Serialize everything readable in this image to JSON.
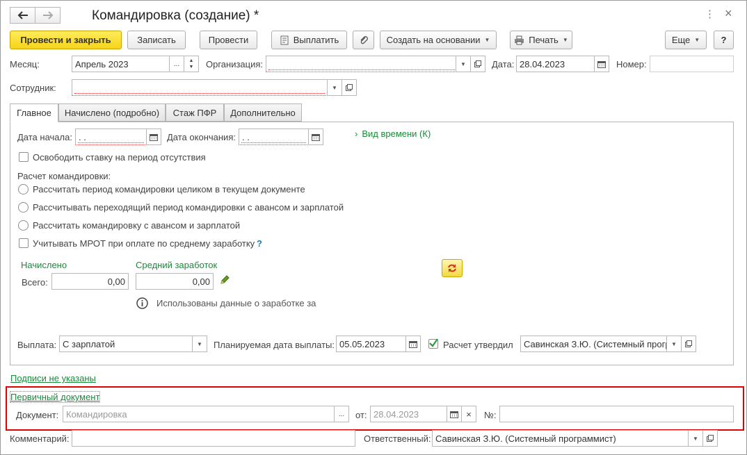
{
  "window": {
    "title": "Командировка (создание) *",
    "more_icon": "⋮",
    "close_icon": "×"
  },
  "toolbar": {
    "post_close": "Провести и закрыть",
    "save": "Записать",
    "post": "Провести",
    "pay": "Выплатить",
    "create_based": "Создать на основании",
    "print": "Печать",
    "more": "Еще",
    "help": "?"
  },
  "header": {
    "month_label": "Месяц:",
    "month_value": "Апрель 2023",
    "org_label": "Организация:",
    "org_value": "",
    "date_label": "Дата:",
    "date_value": "28.04.2023",
    "number_label": "Номер:",
    "number_value": "",
    "employee_label": "Сотрудник:",
    "employee_value": ""
  },
  "tabs": [
    "Главное",
    "Начислено (подробно)",
    "Стаж ПФР",
    "Дополнительно"
  ],
  "main": {
    "start_label": "Дата начала:",
    "start_value": " .  .",
    "end_label": "Дата окончания:",
    "end_value": " .  .",
    "time_type": "Вид времени (К)",
    "free_rate": "Освободить ставку на период отсутствия",
    "calc_label": "Расчет командировки:",
    "radio_options": [
      "Рассчитать период командировки целиком в текущем документе",
      "Рассчитывать переходящий период командировки с авансом и зарплатой",
      "Рассчитать командировку с авансом и зарплатой"
    ],
    "mrot": "Учитывать МРОТ при оплате по среднему заработку",
    "mrot_help": "?",
    "accrued_head": "Начислено",
    "avg_head": "Средний заработок",
    "total_label": "Всего:",
    "total_value": "0,00",
    "avg_value": "0,00",
    "info_text": "Использованы данные о заработке за",
    "payout_label": "Выплата:",
    "payout_value": "С зарплатой",
    "planned_label": "Планируемая дата выплаты:",
    "planned_value": "05.05.2023",
    "approved_label": "Расчет утвердил",
    "approved_value": "Савинская З.Ю. (Системный прогр"
  },
  "footer": {
    "signatures": "Подписи не указаны",
    "primary_doc": "Первичный документ",
    "doc_label": "Документ:",
    "doc_placeholder": "Командировка",
    "from_label": "от:",
    "from_value": "28.04.2023",
    "num_label": "№:",
    "num_value": "",
    "comment_label": "Комментарий:",
    "comment_value": "",
    "responsible_label": "Ответственный:",
    "responsible_value": "Савинская З.Ю. (Системный программист)"
  },
  "colors": {
    "primary": "#f6d418",
    "green": "#1a8a3a",
    "highlight": "#e00000"
  }
}
